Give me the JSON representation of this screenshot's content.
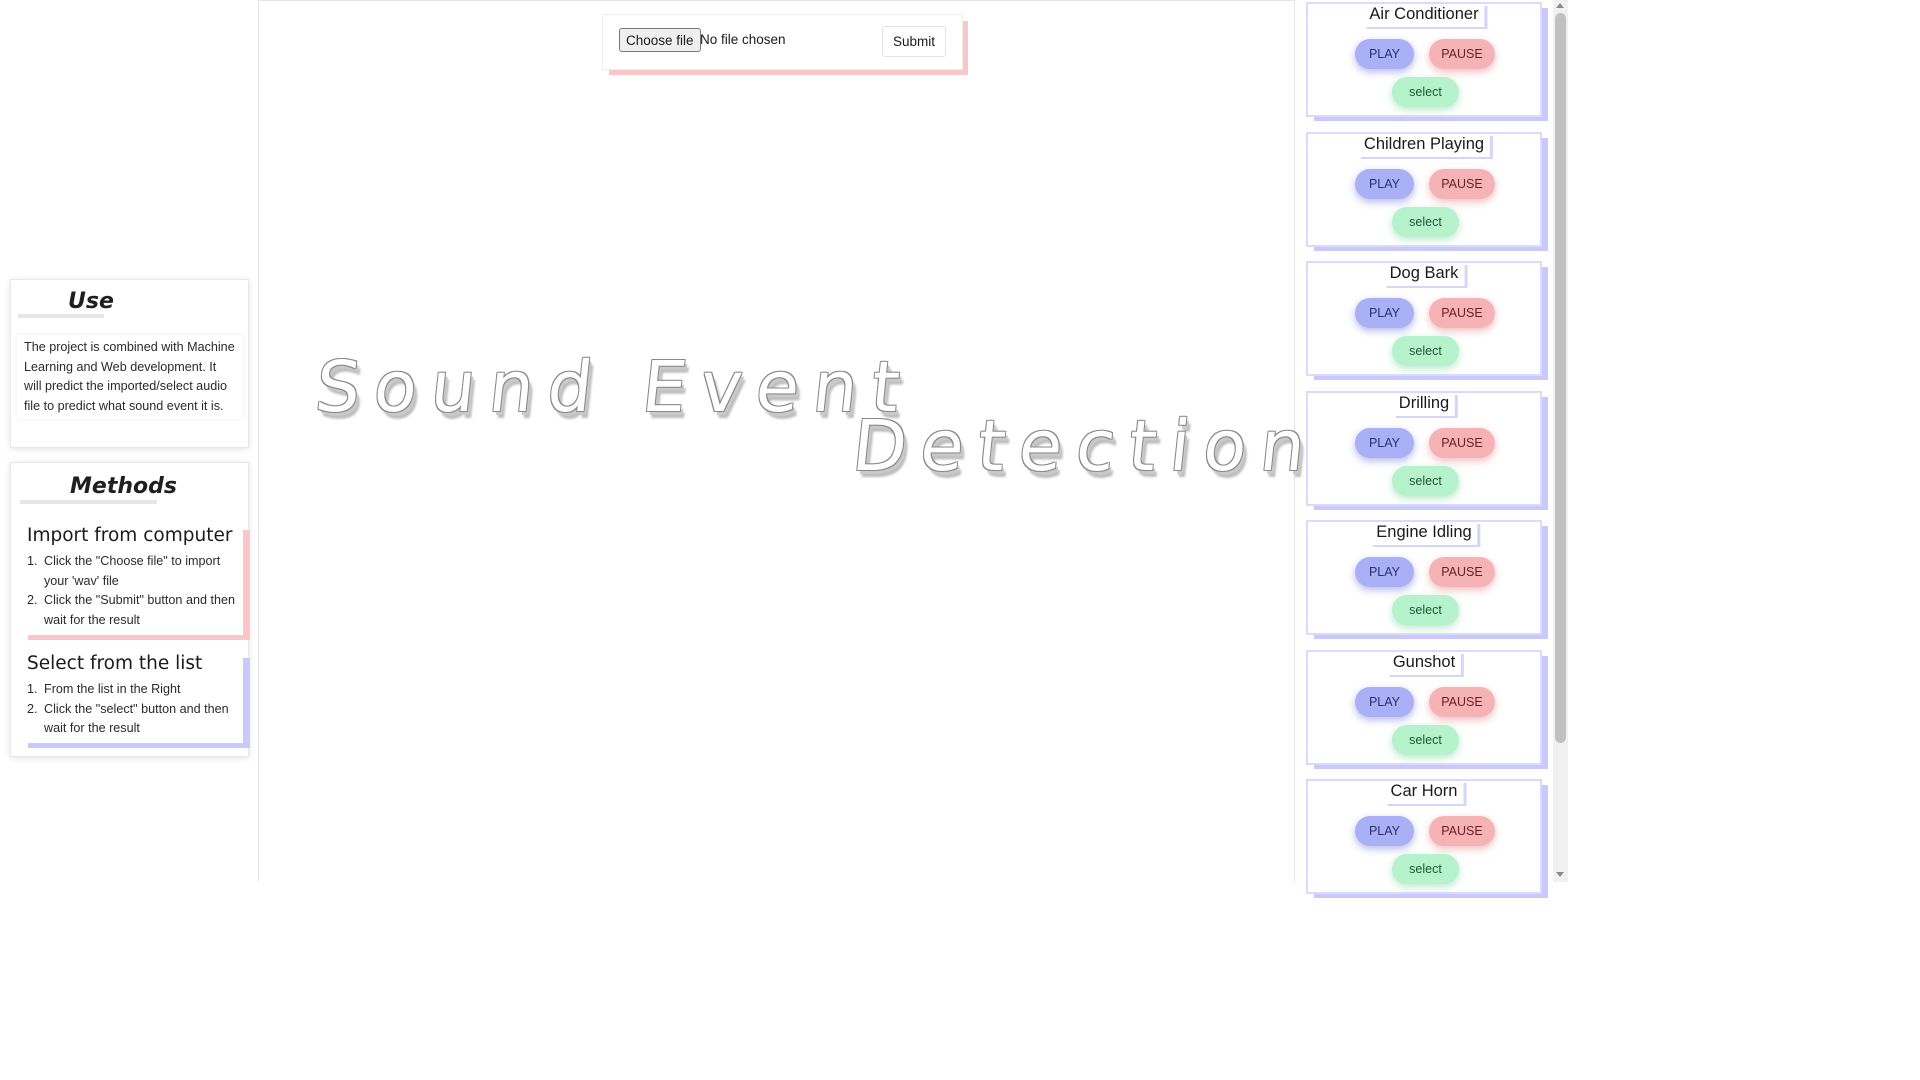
{
  "use": {
    "title": "Use",
    "text": "The project is combined with Machine Learning and Web development. It will predict the imported/select audio file to predict what sound event it is."
  },
  "methods": {
    "title": "Methods",
    "blocks": [
      {
        "heading": "Import from computer",
        "steps": [
          {
            "num": "1.",
            "text": "Click the \"Choose file\" to import your 'wav' file"
          },
          {
            "num": "2.",
            "text": "Click the \"Submit\" button and then wait for the result"
          }
        ]
      },
      {
        "heading": "Select from the list",
        "steps": [
          {
            "num": "1.",
            "text": "From the list in the Right"
          },
          {
            "num": "2.",
            "text": "Click the \"select\" button and then wait for the result"
          }
        ]
      }
    ]
  },
  "upload": {
    "choose_label": "Choose file",
    "status": "No file chosen",
    "submit_label": "Submit"
  },
  "hero": {
    "line1": "Sound Event",
    "line2": "Detection"
  },
  "buttons": {
    "play": "PLAY",
    "pause": "PAUSE",
    "select": "select"
  },
  "sounds": [
    "Air Conditioner",
    "Children Playing",
    "Dog Bark",
    "Drilling",
    "Engine Idling",
    "Gunshot",
    "Car Horn"
  ],
  "colors": {
    "play": "#aab0f5",
    "pause": "#f6b3b6",
    "select": "#b6f2cc",
    "accent_pink": "#fbc6c8",
    "accent_lavender": "#c9c9fb"
  }
}
